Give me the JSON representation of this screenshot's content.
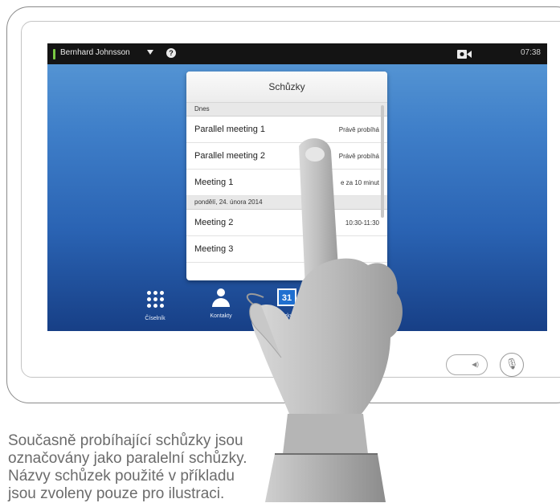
{
  "status_bar": {
    "user_name": "Bernhard Johnsson",
    "help_glyph": "?",
    "clock": "07:38",
    "presence_color": "#7ac943"
  },
  "popup": {
    "title": "Schůzky",
    "sections": [
      {
        "header": "Dnes",
        "rows": [
          {
            "name": "Parallel meeting 1",
            "status": "Právě probíhá"
          },
          {
            "name": "Parallel meeting 2",
            "status": "Právě probíhá"
          },
          {
            "name": "Meeting 1",
            "status": "e za 10 minut"
          }
        ]
      },
      {
        "header": "pondělí, 24. února 2014",
        "rows": [
          {
            "name": "Meeting 2",
            "status": "10:30-11:30"
          },
          {
            "name": "Meeting 3",
            "status": ""
          }
        ]
      }
    ]
  },
  "dock": {
    "items": [
      {
        "label": "Číselník",
        "icon": "keypad-icon"
      },
      {
        "label": "Kontakty",
        "icon": "contacts-icon"
      },
      {
        "label": "ůzky",
        "icon": "calendar-icon",
        "calendar_day": "31"
      }
    ]
  },
  "caption": {
    "lines": [
      "Současně probíhající schůzky jsou",
      "označovány jako paralelní schůzky.",
      "Názvy schůzek použité v příkladu",
      "jsou zvoleny pouze pro ilustraci."
    ]
  }
}
